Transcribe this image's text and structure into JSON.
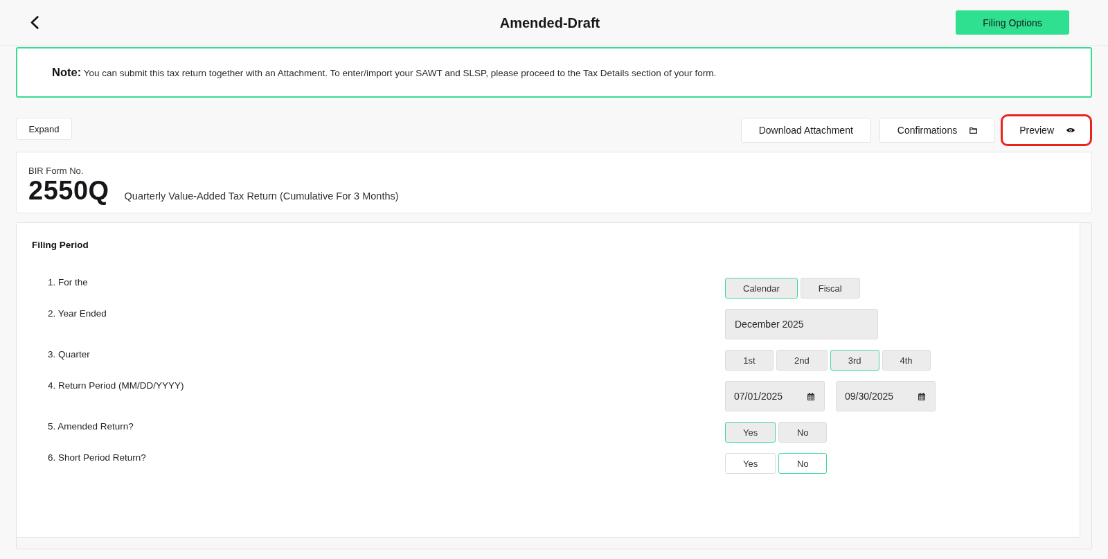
{
  "header": {
    "title": "Amended-Draft",
    "filing_options_button": "Filing Options"
  },
  "note": {
    "label": "Note:",
    "text": "You can submit this tax return together with an Attachment. To enter/import your SAWT and SLSP, please proceed to the Tax Details section of your form."
  },
  "toolbar": {
    "expand_button": "Expand",
    "download_button": {
      "label": "Download Attachment",
      "highlighted": false
    },
    "confirmations_button": {
      "label": "Confirmations",
      "highlighted": false
    },
    "preview_button": {
      "label": "Preview",
      "highlighted": true
    }
  },
  "form_header": {
    "caption": "BIR Form No.",
    "number": "2550Q",
    "description": "Quarterly Value-Added Tax Return (Cumulative For 3 Months)"
  },
  "filing_period": {
    "title": "Filing Period",
    "items": [
      {
        "kind": "choice",
        "label": "1. For the",
        "disabled": true,
        "options": [
          {
            "label": "Calendar",
            "selected": true
          },
          {
            "label": "Fiscal",
            "selected": false
          }
        ]
      },
      {
        "kind": "month",
        "label": "2. Year Ended",
        "disabled": true,
        "value": "December 2025"
      },
      {
        "kind": "choice",
        "label": "3. Quarter",
        "disabled": true,
        "options": [
          {
            "label": "1st",
            "selected": false
          },
          {
            "label": "2nd",
            "selected": false
          },
          {
            "label": "3rd",
            "selected": true
          },
          {
            "label": "4th",
            "selected": false
          }
        ]
      },
      {
        "kind": "dates",
        "label": "4. Return Period (MM/DD/YYYY)",
        "disabled": true,
        "values": [
          "07/01/2025",
          "09/30/2025"
        ]
      },
      {
        "kind": "choice",
        "label": "5. Amended Return?",
        "disabled": true,
        "options": [
          {
            "label": "Yes",
            "selected": true
          },
          {
            "label": "No",
            "selected": false
          }
        ]
      },
      {
        "kind": "choice",
        "label": "6. Short Period Return?",
        "disabled": false,
        "options": [
          {
            "label": "Yes",
            "selected": false
          },
          {
            "label": "No",
            "selected": true
          }
        ]
      }
    ]
  }
}
